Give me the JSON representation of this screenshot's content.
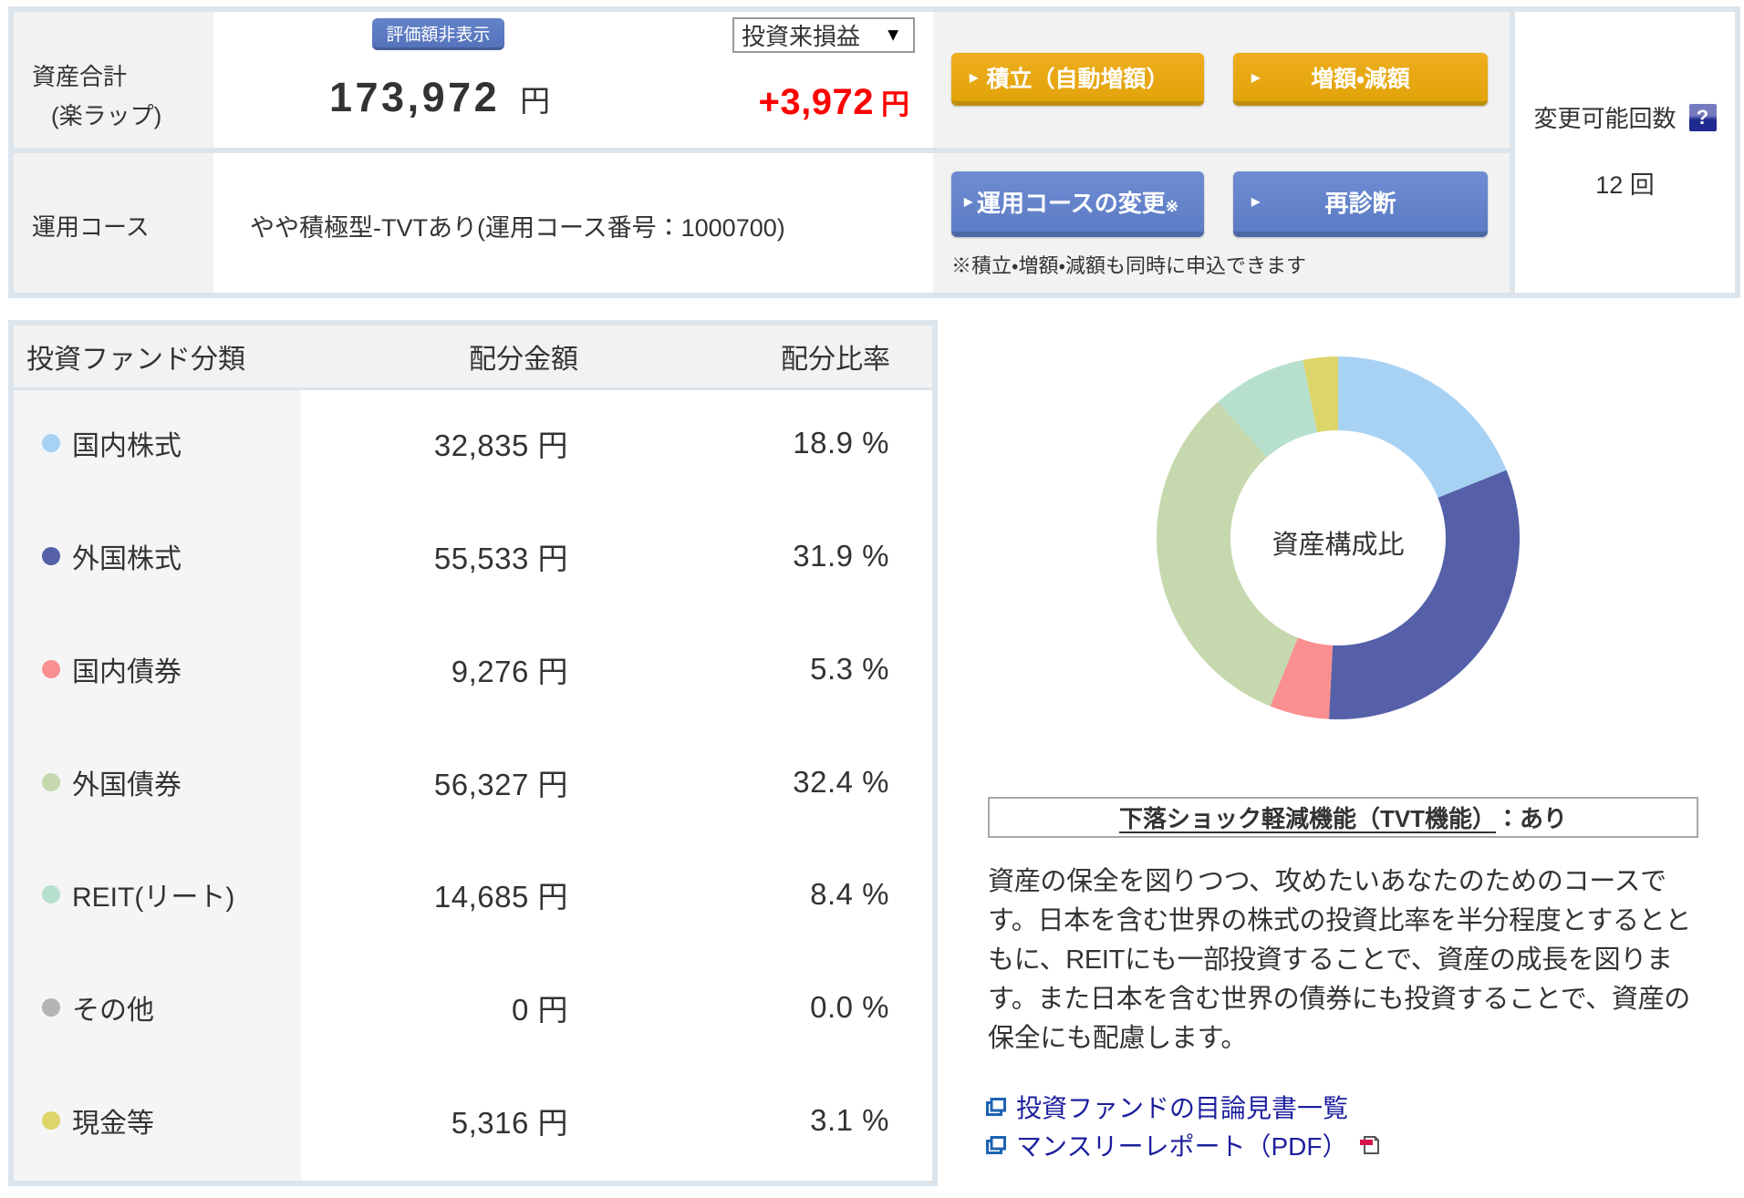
{
  "colors": {
    "frame": "#dce4ec",
    "cell_gray": "#f2f2f2",
    "row_label_gray": "#f5f5f5",
    "text": "#333333",
    "accent_red": "#ff0000",
    "button_orange_top": "#eeae1f",
    "button_orange_bottom": "#e2a30a",
    "button_orange_border": "#bf8e0e",
    "button_blue_top": "#6f8cd2",
    "button_blue_bottom": "#5c7cc5",
    "button_blue_border": "#4c68a4",
    "badge_blue_top": "#6383c9",
    "badge_blue_bottom": "#5573bb",
    "badge_blue_border": "#445d9a",
    "link_blue": "#1d1f9e",
    "help_icon_top": "#767bc0",
    "help_icon_bottom": "#1f2a8e"
  },
  "summary": {
    "total_label_line1": "資産合計",
    "total_label_line2": "(楽ラップ)",
    "hide_value_button": "評価額非表示",
    "total_value": "173,972",
    "currency": "円",
    "pl_selector": "投資来損益",
    "caret": "▼",
    "pl_value": "+3,972",
    "tsumitate_button": "積立（自動増額）",
    "zogaku_button": "増額・減額",
    "course_label": "運用コース",
    "course_name": "やや積極型-TVTあり(運用コース番号：1000700)",
    "course_change_button": "運用コースの変更",
    "course_change_kome": "※",
    "rediagnose_button": "再診断",
    "note": "※積立・増額・減額も同時に申込できます",
    "triangle": "▶",
    "change_count_label": "変更可能回数",
    "help_icon": "?",
    "change_count_value": "12 回"
  },
  "table": {
    "headers": [
      "投資ファンド分類",
      "配分金額",
      "配分比率"
    ],
    "rows": [
      {
        "label": "国内株式",
        "amount": "32,835 円",
        "ratio": "18.9 %",
        "color": "#a8d2f4"
      },
      {
        "label": "外国株式",
        "amount": "55,533 円",
        "ratio": "31.9 %",
        "color": "#5560a8"
      },
      {
        "label": "国内債券",
        "amount": "9,276 円",
        "ratio": "5.3 %",
        "color": "#f98f8f"
      },
      {
        "label": "外国債券",
        "amount": "56,327 円",
        "ratio": "32.4 %",
        "color": "#c6d8ae"
      },
      {
        "label": "REIT(リート)",
        "amount": "14,685 円",
        "ratio": "8.4 %",
        "color": "#b7dfcd"
      },
      {
        "label": "その他",
        "amount": "0 円",
        "ratio": "0.0 %",
        "color": "#b4b4b4"
      },
      {
        "label": "現金等",
        "amount": "5,316 円",
        "ratio": "3.1 %",
        "color": "#dcd56a"
      }
    ]
  },
  "chart_data": {
    "type": "pie",
    "subtype": "donut",
    "title": "資産構成比",
    "categories": [
      "国内株式",
      "外国株式",
      "国内債券",
      "外国債券",
      "REIT(リート)",
      "その他",
      "現金等"
    ],
    "values_percent": [
      18.9,
      31.9,
      5.3,
      32.4,
      8.4,
      0.0,
      3.1
    ],
    "values_yen": [
      32835,
      55533,
      9276,
      56327,
      14685,
      0,
      5316
    ],
    "colors": [
      "#a8d2f4",
      "#5560a8",
      "#f98f8f",
      "#c6d8ae",
      "#b7dfcd",
      "#b4b4b4",
      "#dcd56a"
    ],
    "start_angle_deg": 0,
    "clockwise": true,
    "outer_radius_px": 199,
    "inner_radius_px": 118,
    "legend_position": "none"
  },
  "tvt": {
    "title_link": "下落ショック軽減機能（TVT機能）",
    "suffix": "：あり"
  },
  "description_lines": [
    "資産の保全を図りつつ、攻めたいあなたのためのコースで",
    "す。日本を含む世界の株式の投資比率を半分程度とするとと",
    "もに、REITにも一部投資することで、資産の成長を図りま",
    "す。また日本を含む世界の債券にも投資することで、資産の",
    "保全にも配慮します。"
  ],
  "links": [
    {
      "label": "投資ファンドの目論見書一覧",
      "pdf": false
    },
    {
      "label": "マンスリーレポート（PDF）",
      "pdf": true
    }
  ]
}
